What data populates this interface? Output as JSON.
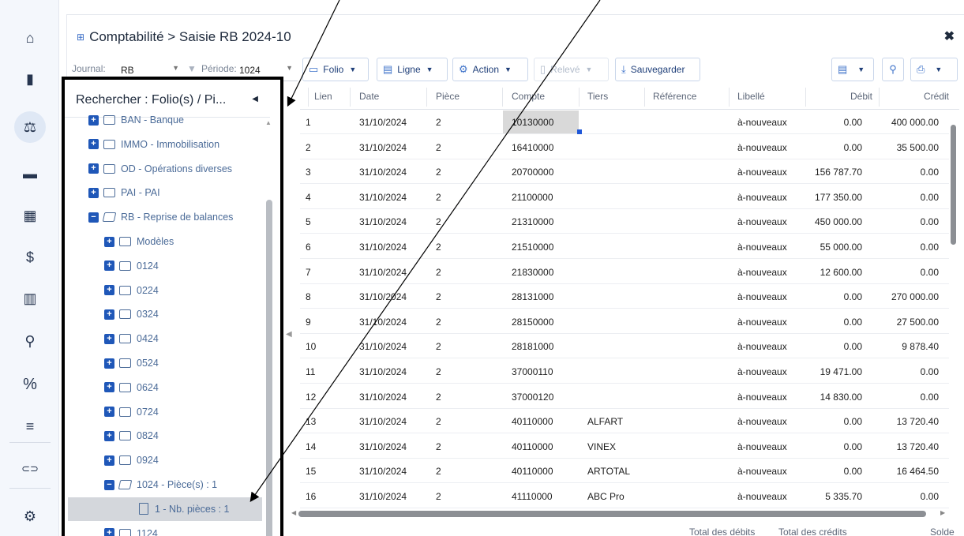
{
  "rail": {
    "items": [
      "home-icon",
      "book-icon",
      "scales-icon",
      "money-card-icon",
      "calculator-icon",
      "dollar-icon",
      "building-icon",
      "stamp-icon",
      "percent-icon",
      "list-icon",
      "link-icon",
      "gear-icon"
    ],
    "active_index": 2
  },
  "header": {
    "title": "Comptabilité > Saisie RB 2024-10"
  },
  "toolbar": {
    "journal_label": "Journal:",
    "journal_value": "RB",
    "periode_label": "Période:",
    "periode_value": "1024",
    "folio": "Folio",
    "ligne": "Ligne",
    "action": "Action",
    "releve": "Relevé",
    "sauvegarder": "Sauvegarder"
  },
  "tree": {
    "title": "Rechercher : Folio(s) / Pi...",
    "items": [
      {
        "label": "BAN - Banque",
        "depth": 0,
        "type": "folder",
        "sign": "+"
      },
      {
        "label": "IMMO - Immobilisation",
        "depth": 0,
        "type": "folder",
        "sign": "+"
      },
      {
        "label": "OD - Opérations diverses",
        "depth": 0,
        "type": "folder",
        "sign": "+"
      },
      {
        "label": "PAI - PAI",
        "depth": 0,
        "type": "folder",
        "sign": "+"
      },
      {
        "label": "RB - Reprise de balances",
        "depth": 0,
        "type": "folder-open",
        "sign": "−"
      },
      {
        "label": "Modèles",
        "depth": 1,
        "type": "folder",
        "sign": "+"
      },
      {
        "label": "0124",
        "depth": 1,
        "type": "folder",
        "sign": "+"
      },
      {
        "label": "0224",
        "depth": 1,
        "type": "folder",
        "sign": "+"
      },
      {
        "label": "0324",
        "depth": 1,
        "type": "folder",
        "sign": "+"
      },
      {
        "label": "0424",
        "depth": 1,
        "type": "folder",
        "sign": "+"
      },
      {
        "label": "0524",
        "depth": 1,
        "type": "folder",
        "sign": "+"
      },
      {
        "label": "0624",
        "depth": 1,
        "type": "folder",
        "sign": "+"
      },
      {
        "label": "0724",
        "depth": 1,
        "type": "folder",
        "sign": "+"
      },
      {
        "label": "0824",
        "depth": 1,
        "type": "folder",
        "sign": "+"
      },
      {
        "label": "0924",
        "depth": 1,
        "type": "folder",
        "sign": "+"
      },
      {
        "label": "1024 - Pièce(s) : 1",
        "depth": 1,
        "type": "folder-open",
        "sign": "−"
      },
      {
        "label": "1 - Nb. pièces : 1",
        "depth": 2,
        "type": "doc",
        "sign": ""
      },
      {
        "label": "1124",
        "depth": 1,
        "type": "folder",
        "sign": "+"
      }
    ]
  },
  "grid": {
    "columns": [
      "Lien",
      "Date",
      "Pièce",
      "Compte",
      "Tiers",
      "Référence",
      "Libellé",
      "Débit",
      "Crédit"
    ],
    "rows": [
      [
        "1",
        "31/10/2024",
        "2",
        "10130000",
        "",
        "",
        "à-nouveaux",
        "0.00",
        "400 000.00"
      ],
      [
        "2",
        "31/10/2024",
        "2",
        "16410000",
        "",
        "",
        "à-nouveaux",
        "0.00",
        "35 500.00"
      ],
      [
        "3",
        "31/10/2024",
        "2",
        "20700000",
        "",
        "",
        "à-nouveaux",
        "156 787.70",
        "0.00"
      ],
      [
        "4",
        "31/10/2024",
        "2",
        "21100000",
        "",
        "",
        "à-nouveaux",
        "177 350.00",
        "0.00"
      ],
      [
        "5",
        "31/10/2024",
        "2",
        "21310000",
        "",
        "",
        "à-nouveaux",
        "450 000.00",
        "0.00"
      ],
      [
        "6",
        "31/10/2024",
        "2",
        "21510000",
        "",
        "",
        "à-nouveaux",
        "55 000.00",
        "0.00"
      ],
      [
        "7",
        "31/10/2024",
        "2",
        "21830000",
        "",
        "",
        "à-nouveaux",
        "12 600.00",
        "0.00"
      ],
      [
        "8",
        "31/10/2024",
        "2",
        "28131000",
        "",
        "",
        "à-nouveaux",
        "0.00",
        "270 000.00"
      ],
      [
        "9",
        "31/10/2024",
        "2",
        "28150000",
        "",
        "",
        "à-nouveaux",
        "0.00",
        "27 500.00"
      ],
      [
        "10",
        "31/10/2024",
        "2",
        "28181000",
        "",
        "",
        "à-nouveaux",
        "0.00",
        "9 878.40"
      ],
      [
        "11",
        "31/10/2024",
        "2",
        "37000110",
        "",
        "",
        "à-nouveaux",
        "19 471.00",
        "0.00"
      ],
      [
        "12",
        "31/10/2024",
        "2",
        "37000120",
        "",
        "",
        "à-nouveaux",
        "14 830.00",
        "0.00"
      ],
      [
        "13",
        "31/10/2024",
        "2",
        "40110000",
        "ALFART",
        "",
        "à-nouveaux",
        "0.00",
        "13 720.40"
      ],
      [
        "14",
        "31/10/2024",
        "2",
        "40110000",
        "VINEX",
        "",
        "à-nouveaux",
        "0.00",
        "13 720.40"
      ],
      [
        "15",
        "31/10/2024",
        "2",
        "40110000",
        "ARTOTAL",
        "",
        "à-nouveaux",
        "0.00",
        "16 464.50"
      ],
      [
        "16",
        "31/10/2024",
        "2",
        "41110000",
        "ABC Pro",
        "",
        "à-nouveaux",
        "5 335.70",
        "0.00"
      ]
    ]
  },
  "footer": {
    "total_debits": "Total des débits",
    "total_credits": "Total des crédits",
    "solde": "Solde"
  },
  "colors": {
    "accent": "#1f57b8",
    "tree_text": "#4b6b98",
    "selection": "#d9d9d9"
  }
}
